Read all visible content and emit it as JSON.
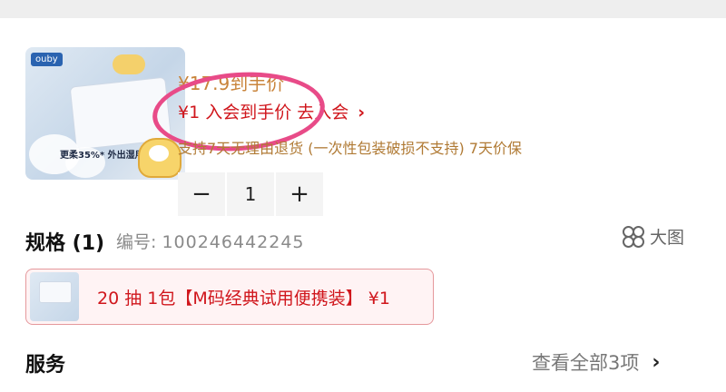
{
  "product": {
    "image_brand": "ouby",
    "image_tagline": "更柔35%* 外出湿用不"
  },
  "price": {
    "arrival_price": "¥17.9到手价",
    "member_price_text": "¥1 入会到手价 去入会",
    "member_chevron": "›",
    "return_policy": "支持7天无理由退货 (一次性包装破损不支持) 7天价保"
  },
  "stepper": {
    "minus": "−",
    "value": "1",
    "plus": "+"
  },
  "spec": {
    "title": "规格 (1)",
    "code_label": "编号:",
    "code_value": "100246442245",
    "big_image_label": "大图"
  },
  "variant": {
    "label": "20 抽 1包【M码经典试用便携装】 ¥1"
  },
  "service": {
    "title": "服务",
    "link_text": "查看全部3项",
    "chevron": "›"
  },
  "colors": {
    "accent_red": "#d0161c",
    "price_orange": "#c9843b",
    "annotation_pink": "#e84b88"
  }
}
